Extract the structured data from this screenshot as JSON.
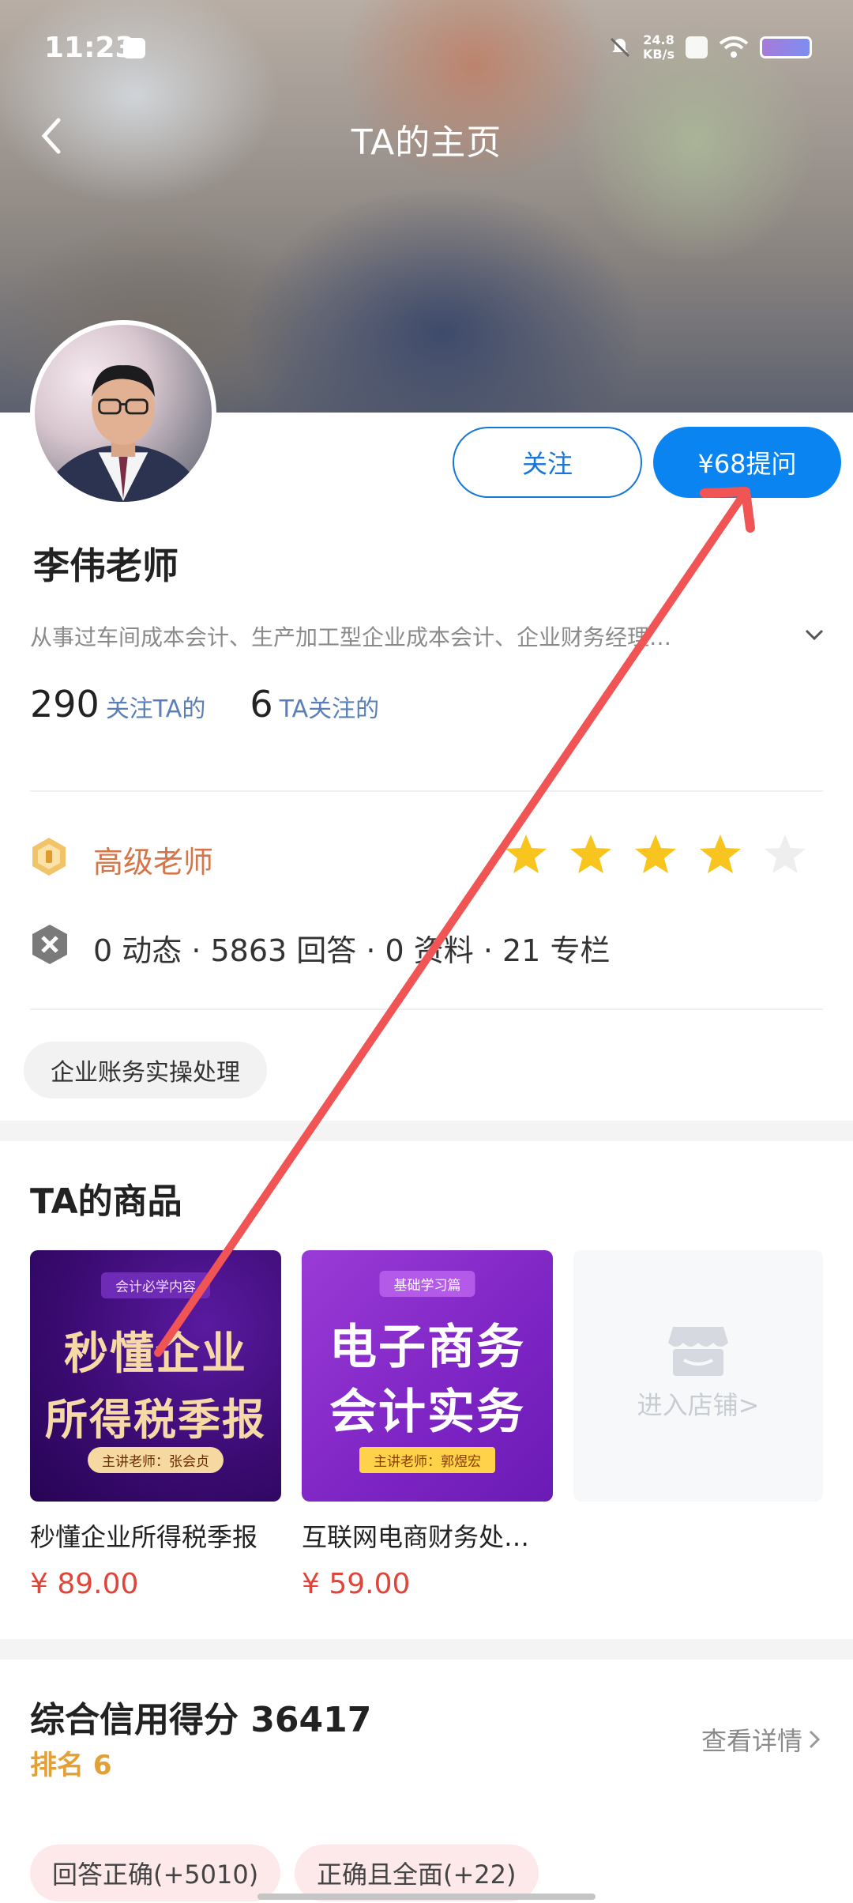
{
  "status_bar": {
    "time": "11:23",
    "speed": "24.8",
    "speed_unit": "KB/s"
  },
  "nav": {
    "title": "TA的主页"
  },
  "profile": {
    "follow_label": "关注",
    "ask_label": "¥68提问",
    "name": "李伟老师",
    "bio": "从事过车间成本会计、生产加工型企业成本会计、企业财务经理…",
    "followers_count": "290",
    "followers_label": "关注TA的",
    "following_count": "6",
    "following_label": "TA关注的",
    "level": "高级老师",
    "rating": {
      "filled": 4,
      "total": 5
    },
    "activity": "0 动态 · 5863 回答 · 0 资料 · 21 专栏",
    "tag": "企业账务实操处理"
  },
  "products": {
    "title": "TA的商品",
    "items": [
      {
        "name": "秒懂企业所得税季报",
        "price": "¥ 89.00",
        "cover_top": "会计必学内容",
        "cover_line1": "秒懂企业",
        "cover_line2": "所得税季报",
        "cover_bottom": "主讲老师：张会贞"
      },
      {
        "name": "互联网电商财务处…",
        "price": "¥ 59.00",
        "cover_top": "基础学习篇",
        "cover_line1": "电子商务",
        "cover_line2": "会计实务",
        "cover_bottom": "主讲老师：郭煜宏"
      }
    ],
    "shop_label": "进入店铺>"
  },
  "credit": {
    "title": "综合信用得分 36417",
    "rank": "排名 6",
    "detail_label": "查看详情",
    "chips": [
      "回答正确(+5010)",
      "正确且全面(+22)"
    ]
  },
  "colors": {
    "accent": "#0a84f0",
    "price": "#e0453a",
    "level": "#d4764a",
    "rank": "#e3a036",
    "star": "#f7c51e",
    "annotation_arrow": "#f05454"
  }
}
